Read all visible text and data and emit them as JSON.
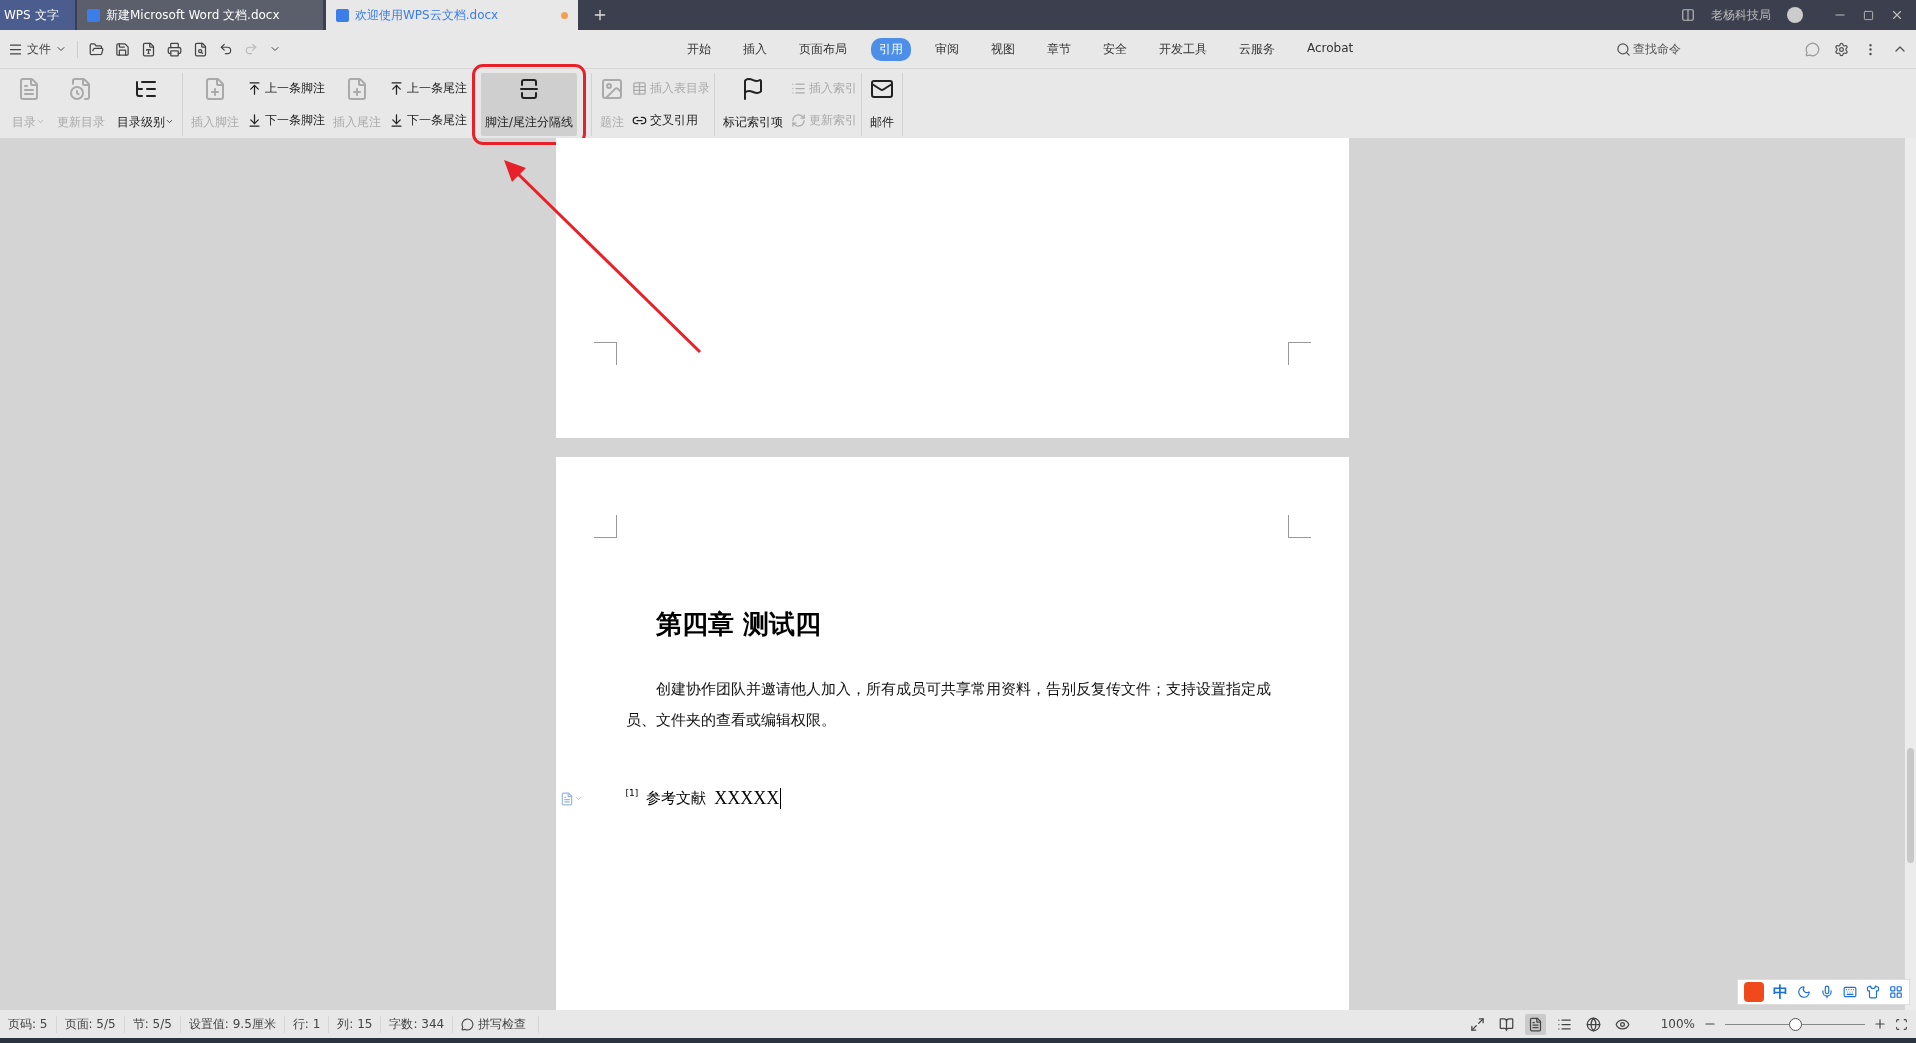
{
  "title_bar": {
    "app_label": "WPS 文字",
    "tabs": [
      {
        "label": "新建Microsoft Word 文档.docx",
        "selected": false,
        "modified": false
      },
      {
        "label": "欢迎使用WPS云文档.docx",
        "selected": true,
        "modified": true
      }
    ],
    "user_name": "老杨科技局"
  },
  "menu_bar": {
    "file_label": "文件",
    "tabs": [
      {
        "label": "开始",
        "selected": false
      },
      {
        "label": "插入",
        "selected": false
      },
      {
        "label": "页面布局",
        "selected": false
      },
      {
        "label": "引用",
        "selected": true
      },
      {
        "label": "审阅",
        "selected": false
      },
      {
        "label": "视图",
        "selected": false
      },
      {
        "label": "章节",
        "selected": false
      },
      {
        "label": "安全",
        "selected": false
      },
      {
        "label": "开发工具",
        "selected": false
      },
      {
        "label": "云服务",
        "selected": false
      },
      {
        "label": "Acrobat",
        "selected": false
      }
    ],
    "search_label": "查找命令"
  },
  "ribbon": {
    "groups": [
      {
        "items": [
          {
            "kind": "large",
            "label": "目录",
            "disabled": true,
            "dropdown": true,
            "selected": false
          },
          {
            "kind": "large",
            "label": "更新目录",
            "disabled": true,
            "dropdown": false,
            "selected": false
          },
          {
            "kind": "large",
            "label": "目录级别",
            "disabled": false,
            "dropdown": true,
            "selected": false
          }
        ]
      },
      {
        "items": [
          {
            "kind": "large",
            "label": "插入脚注",
            "disabled": true,
            "dropdown": false,
            "selected": false
          },
          {
            "kind": "stack",
            "entries": [
              {
                "label": "上一条脚注",
                "disabled": false
              },
              {
                "label": "下一条脚注",
                "disabled": false
              }
            ]
          },
          {
            "kind": "large",
            "label": "插入尾注",
            "disabled": true,
            "dropdown": false,
            "selected": false
          },
          {
            "kind": "stack",
            "entries": [
              {
                "label": "上一条尾注",
                "disabled": false
              },
              {
                "label": "下一条尾注",
                "disabled": false
              }
            ]
          },
          {
            "kind": "large",
            "label": "脚注/尾注分隔线",
            "disabled": false,
            "dropdown": false,
            "selected": true
          }
        ]
      },
      {
        "items": [
          {
            "kind": "large",
            "label": "题注",
            "disabled": true,
            "dropdown": false,
            "selected": false
          },
          {
            "kind": "stack",
            "entries": [
              {
                "label": "插入表目录",
                "disabled": true
              },
              {
                "label": "交叉引用",
                "disabled": false
              }
            ]
          }
        ]
      },
      {
        "items": [
          {
            "kind": "large",
            "label": "标记索引项",
            "disabled": false,
            "dropdown": false,
            "selected": false
          },
          {
            "kind": "stack",
            "entries": [
              {
                "label": "插入索引",
                "disabled": true
              },
              {
                "label": "更新索引",
                "disabled": true
              }
            ]
          }
        ]
      },
      {
        "items": [
          {
            "kind": "large",
            "label": "邮件",
            "disabled": false,
            "dropdown": false,
            "selected": false
          }
        ]
      }
    ]
  },
  "document": {
    "heading": "第四章  测试四",
    "paragraph": "创建协作团队并邀请他人加入，所有成员可共享常用资料，告别反复传文件；支持设置指定成员、文件夹的查看或编辑权限。",
    "footnote": {
      "mark": "[1]",
      "label": "参考文献",
      "text": "XXXXX"
    }
  },
  "ime_bar": {
    "mode": "中"
  },
  "status_bar": {
    "items": [
      "页码: 5",
      "页面: 5/5",
      "节: 5/5",
      "设置值: 9.5厘米",
      "行: 1",
      "列: 15",
      "字数: 344"
    ],
    "spell_check": "拼写检查",
    "views": [
      {
        "selected": false
      },
      {
        "selected": false
      },
      {
        "selected": true
      },
      {
        "selected": false
      },
      {
        "selected": false
      },
      {
        "selected": false
      }
    ],
    "zoom": {
      "label": "100%",
      "level": 0.5
    }
  }
}
